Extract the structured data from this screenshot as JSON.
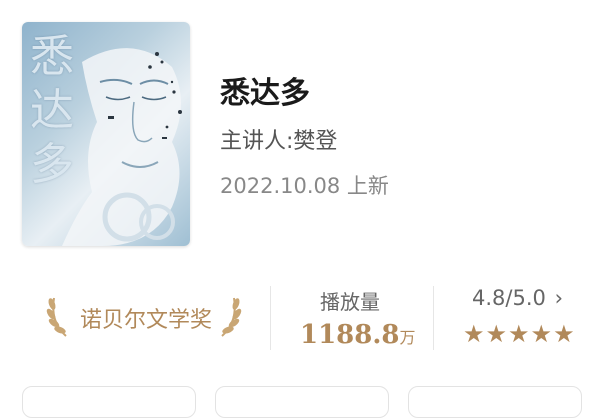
{
  "book": {
    "cover_title": "悉达多",
    "title": "悉达多",
    "speaker": "主讲人:樊登",
    "date": "2022.10.08 上新"
  },
  "stats": {
    "award": "诺贝尔文学奖",
    "plays_label": "播放量",
    "plays_value": "1188.8",
    "plays_unit": "万",
    "rating": "4.8/5.0",
    "rating_arrow": "›",
    "stars": "★★★★★",
    "rating_score": 4.8,
    "rating_max": 5.0
  },
  "colors": {
    "accent": "#b1895a",
    "cover_blue": "#8fb3cc"
  },
  "icons": {
    "award_left": "laurel-left-icon",
    "award_right": "laurel-right-icon",
    "chevron": "chevron-right-icon"
  }
}
